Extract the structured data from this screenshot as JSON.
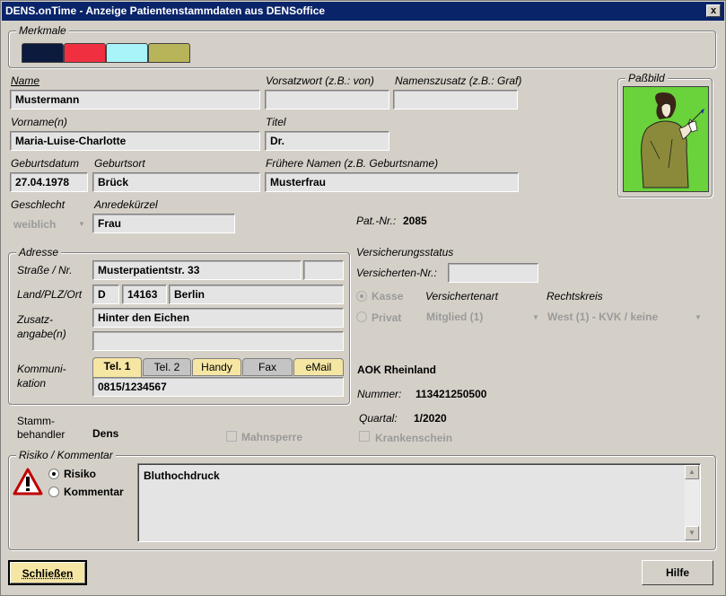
{
  "window": {
    "title": "DENS.onTime - Anzeige Patientenstammdaten aus DENSoffice",
    "close_label": "x"
  },
  "merkmale": {
    "legend": "Merkmale",
    "colors": [
      "#0c1a3e",
      "#f03040",
      "#a8f4f8",
      "#b8b45a"
    ]
  },
  "fields": {
    "name_label": "Name",
    "name_value": "Mustermann",
    "vorsatz_label": "Vorsatzwort (z.B.: von)",
    "vorsatz_value": "",
    "namenszusatz_label": "Namenszusatz (z.B.: Graf)",
    "namenszusatz_value": "",
    "vorname_label": "Vorname(n)",
    "vorname_value": "Maria-Luise-Charlotte",
    "titel_label": "Titel",
    "titel_value": "Dr.",
    "geburtsdatum_label": "Geburtsdatum",
    "geburtsdatum_value": "27.04.1978",
    "geburtsort_label": "Geburtsort",
    "geburtsort_value": "Brück",
    "fruehere_label": "Frühere Namen (z.B. Geburtsname)",
    "fruehere_value": "Musterfrau",
    "geschlecht_label": "Geschlecht",
    "geschlecht_value": "weiblich",
    "anrede_label": "Anredekürzel",
    "anrede_value": "Frau",
    "patnr_label": "Pat.-Nr.:",
    "patnr_value": "2085"
  },
  "photo": {
    "legend": "Paßbild"
  },
  "adresse": {
    "legend": "Adresse",
    "strasse_label": "Straße / Nr.",
    "strasse_value": "Musterpatientstr. 33",
    "nr_value": "",
    "land_label": "Land/PLZ/Ort",
    "land_value": "D",
    "plz_value": "14163",
    "ort_value": "Berlin",
    "zusatz_label_1": "Zusatz-",
    "zusatz_label_2": "angabe(n)",
    "zusatz_value_1": "Hinter den Eichen",
    "zusatz_value_2": "",
    "komm_label_1": "Kommuni-",
    "komm_label_2": "kation",
    "tabs": [
      "Tel. 1",
      "Tel. 2",
      "Handy",
      "Fax",
      "eMail"
    ],
    "komm_value": "0815/1234567"
  },
  "versicherung": {
    "legend": "Versicherungsstatus",
    "versnr_label": "Versicherten-Nr.:",
    "versnr_value": "",
    "kasse_label": "Kasse",
    "privat_label": "Privat",
    "art_label": "Versichertenart",
    "art_value": "Mitglied (1)",
    "kreis_label": "Rechtskreis",
    "kreis_value": "West (1) - KVK / keine",
    "kasse_name": "AOK Rheinland",
    "nummer_label": "Nummer:",
    "nummer_value": "113421250500",
    "quartal_label": "Quartal:",
    "quartal_value": "1/2020",
    "krankenschein_label": "Krankenschein"
  },
  "stamm": {
    "label_1": "Stamm-",
    "label_2": "behandler",
    "value": "Dens",
    "mahnsperre_label": "Mahnsperre"
  },
  "risiko": {
    "legend": "Risiko / Kommentar",
    "risiko_label": "Risiko",
    "kommentar_label": "Kommentar",
    "text": "Bluthochdruck"
  },
  "buttons": {
    "close": "Schließen",
    "help": "Hilfe"
  }
}
